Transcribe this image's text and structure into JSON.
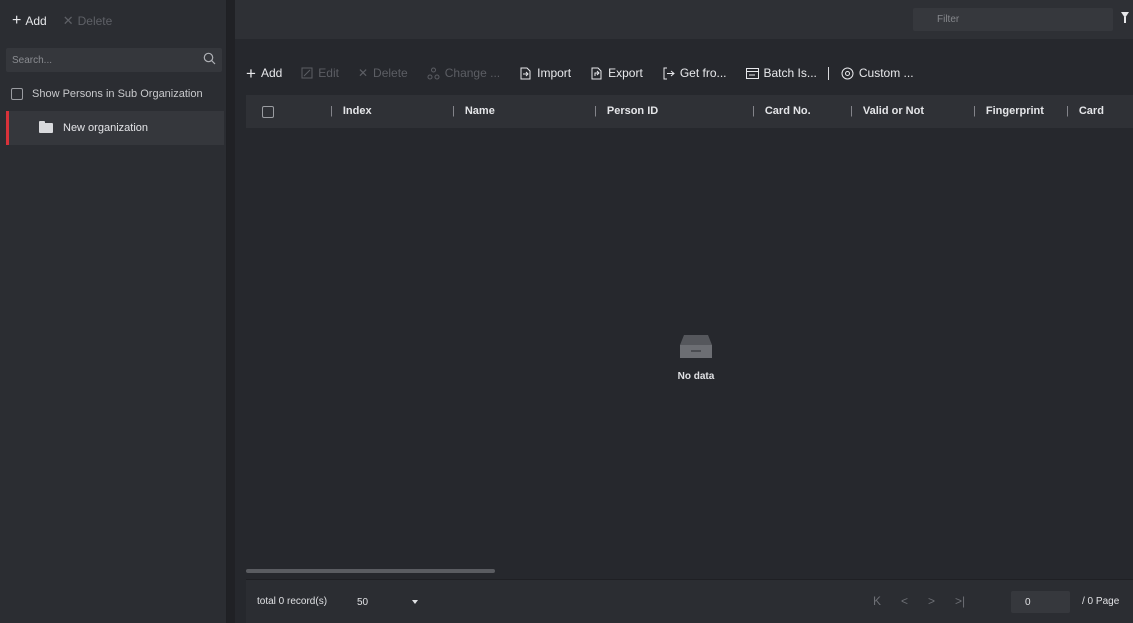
{
  "left_panel": {
    "toolbar": {
      "add_label": "Add",
      "delete_label": "Delete"
    },
    "search": {
      "placeholder": "Search..."
    },
    "show_sub_label": "Show Persons in Sub Organization",
    "org_tree": [
      {
        "label": "New organization",
        "selected": true
      }
    ]
  },
  "topbar": {
    "filter_placeholder": "Filter"
  },
  "toolbar": {
    "add": "Add",
    "edit": "Edit",
    "delete": "Delete",
    "change": "Change ...",
    "import": "Import",
    "export": "Export",
    "get_from": "Get fro...",
    "batch": "Batch Is...",
    "custom": "Custom ..."
  },
  "table": {
    "columns": [
      "Index",
      "Name",
      "Person ID",
      "Card No.",
      "Valid or Not",
      "Fingerprint",
      "Card"
    ],
    "rows": [],
    "empty_text": "No data"
  },
  "footer": {
    "total": "total 0 record(s)",
    "page_size": "50",
    "page_value": "0",
    "page_total": "/ 0 Page"
  },
  "icons": {
    "first_page": "K",
    "prev_page": "<",
    "next_page": ">",
    "last_page": ">|"
  },
  "colors": {
    "selected_accent": "#d8323a",
    "background": "#26282d"
  }
}
